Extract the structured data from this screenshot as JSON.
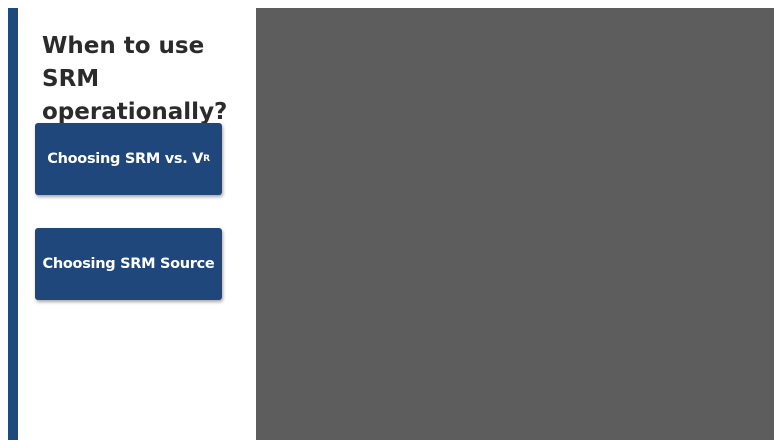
{
  "sidebar": {
    "heading": "When to use SRM operationally?",
    "buttons": [
      {
        "label": "Choosing SRM vs. V",
        "subscript": "R"
      },
      {
        "label": "Choosing SRM Source"
      }
    ]
  },
  "colors": {
    "accent_bar": "#1f4a7c",
    "button_bg": "#1f477c",
    "content_bg": "#5d5d5d",
    "heading_text": "#2b2b2b"
  }
}
